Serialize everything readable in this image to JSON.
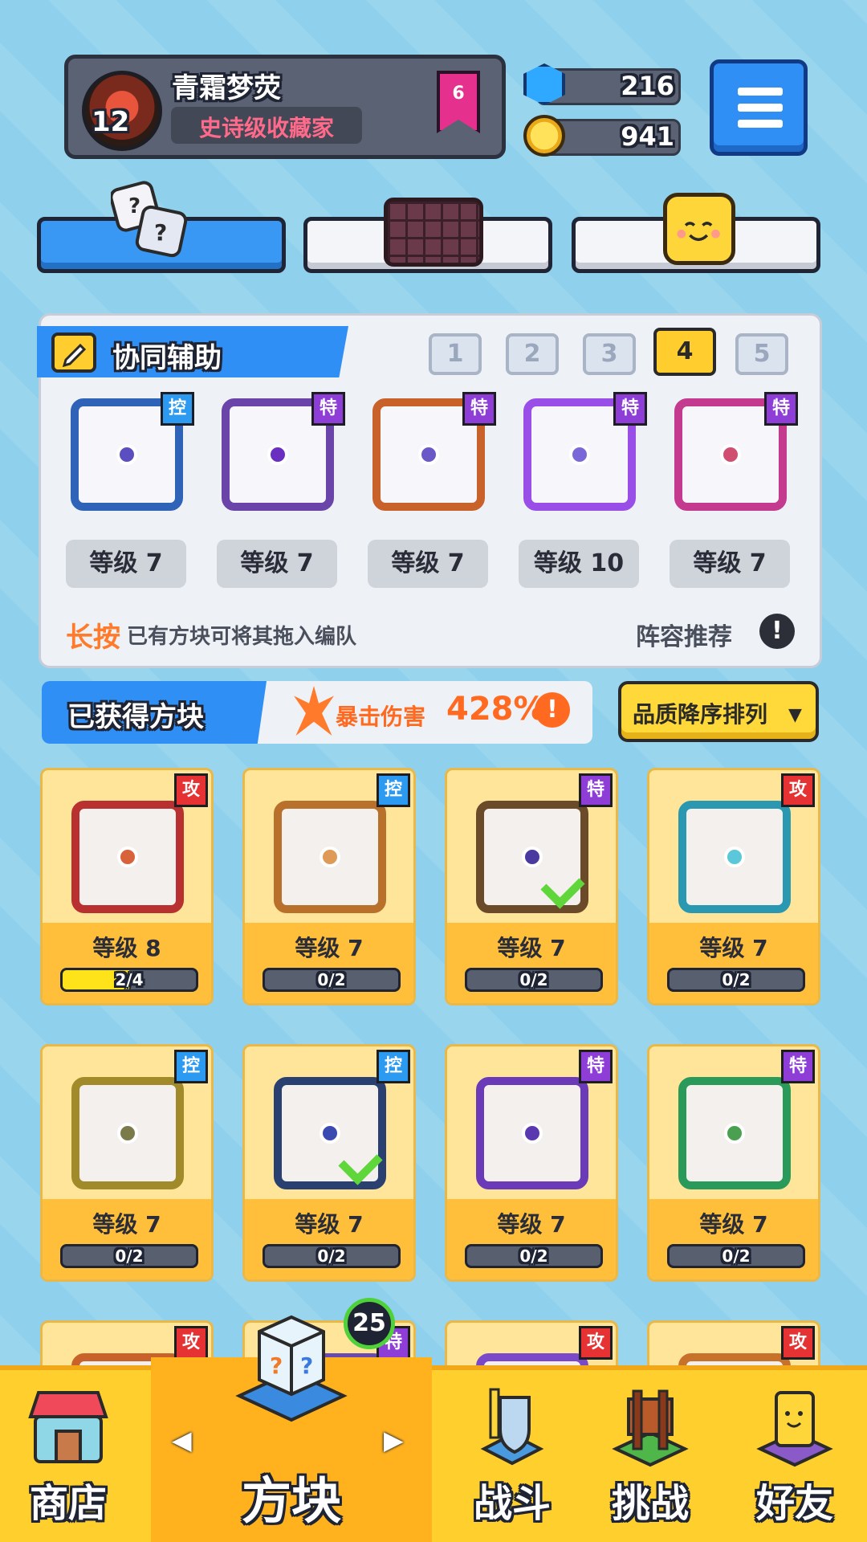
{
  "profile": {
    "name": "青霜梦荧",
    "title": "史诗级收藏家",
    "level": "12",
    "rank": "6"
  },
  "currency": {
    "gems": "216",
    "coins": "941"
  },
  "squad": {
    "title": "协同辅助",
    "presets": [
      "1",
      "2",
      "3",
      "4",
      "5"
    ],
    "active_preset": "4",
    "slots": [
      {
        "tag": "控",
        "level": "等级 7",
        "frame": "#2e63b8",
        "center": "#5a4ec0"
      },
      {
        "tag": "特",
        "level": "等级 7",
        "frame": "#6a44a8",
        "center": "#6a2fc0"
      },
      {
        "tag": "特",
        "level": "等级 7",
        "frame": "#c8612a",
        "center": "#6a58c8"
      },
      {
        "tag": "特",
        "level": "等级 10",
        "frame": "#9a4ee8",
        "center": "#7a68d8"
      },
      {
        "tag": "特",
        "level": "等级 7",
        "frame": "#c43a8e",
        "center": "#d04e70"
      }
    ],
    "hint_emphasis": "长按",
    "hint_text": "已有方块可将其拖入编队",
    "lineup_recommend": "阵容推荐",
    "info_symbol": "!"
  },
  "obtained": {
    "title": "已获得方块",
    "crit_label": "暴击伤害",
    "crit_value": "428%",
    "info_symbol": "!",
    "sort_label": "品质降序排列",
    "sort_arrow": "▼"
  },
  "cards": [
    {
      "tag": "攻",
      "level": "等级 8",
      "progress": "2/4",
      "fill": 0.5,
      "frame": "#b83030",
      "center": "#d8623a",
      "check": false
    },
    {
      "tag": "控",
      "level": "等级 7",
      "progress": "0/2",
      "fill": 0,
      "frame": "#b8702a",
      "center": "#e09a58",
      "check": false
    },
    {
      "tag": "特",
      "level": "等级 7",
      "progress": "0/2",
      "fill": 0,
      "frame": "#6a4a28",
      "center": "#4a3aa0",
      "check": true
    },
    {
      "tag": "攻",
      "level": "等级 7",
      "progress": "0/2",
      "fill": 0,
      "frame": "#2a98b0",
      "center": "#5ac8d8",
      "check": false
    },
    {
      "tag": "控",
      "level": "等级 7",
      "progress": "0/2",
      "fill": 0,
      "frame": "#a08a2a",
      "center": "#7a7a4a",
      "check": false
    },
    {
      "tag": "控",
      "level": "等级 7",
      "progress": "0/2",
      "fill": 0,
      "frame": "#2a4070",
      "center": "#3a4ab0",
      "check": true
    },
    {
      "tag": "特",
      "level": "等级 7",
      "progress": "0/2",
      "fill": 0,
      "frame": "#6a3ab8",
      "center": "#5a38b0",
      "check": false
    },
    {
      "tag": "特",
      "level": "等级 7",
      "progress": "0/2",
      "fill": 0,
      "frame": "#2a9a5a",
      "center": "#4aa050",
      "check": false
    },
    {
      "tag": "攻",
      "level": "",
      "progress": "",
      "fill": 0,
      "frame": "#c8612a",
      "center": "#e0803a",
      "check": false
    },
    {
      "tag": "特",
      "level": "",
      "progress": "",
      "fill": 0,
      "frame": "#6a4ab0",
      "center": "#6a58c8",
      "check": false
    },
    {
      "tag": "攻",
      "level": "",
      "progress": "",
      "fill": 0,
      "frame": "#7a48c8",
      "center": "#6a58c8",
      "check": false
    },
    {
      "tag": "攻",
      "level": "",
      "progress": "",
      "fill": 0,
      "frame": "#c8712a",
      "center": "#e0803a",
      "check": false
    }
  ],
  "tag_colors": {
    "攻": "#e63232",
    "控": "#2b9af0",
    "特": "#8e3ed6"
  },
  "nav": {
    "shop": "商店",
    "blocks": "方块",
    "battle": "战斗",
    "challenge": "挑战",
    "friends": "好友",
    "badge": "25",
    "left_arrow": "◀",
    "right_arrow": "▶"
  },
  "icons": {
    "menu": "hamburger-menu-icon",
    "gem": "gem-icon",
    "coin": "coin-icon",
    "dice": "dice-icon",
    "board": "board-icon",
    "emoji": "smiley-face-icon",
    "edit": "pencil-icon",
    "crit": "crit-burst-icon"
  }
}
